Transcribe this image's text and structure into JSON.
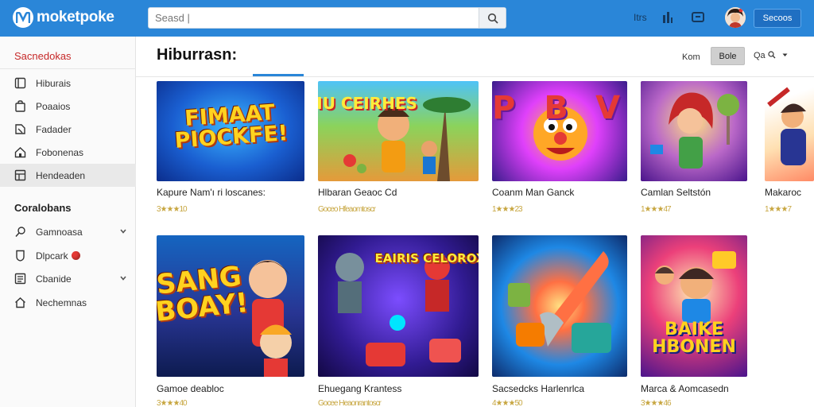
{
  "app": {
    "logo_text": "moketpoke",
    "logo_icon": "m-logo-icon"
  },
  "header": {
    "search_placeholder": "Seasd |",
    "link1": "Itrs",
    "action_button": "Secoos"
  },
  "sidebar": {
    "section1_title": "Sacnedokas",
    "items": [
      {
        "label": "Hiburais",
        "icon": "library-icon"
      },
      {
        "label": "Poaaios",
        "icon": "bag-icon"
      },
      {
        "label": "Fadader",
        "icon": "tag-icon"
      },
      {
        "label": "Fobonenas",
        "icon": "home-icon"
      },
      {
        "label": "Hendeaden",
        "icon": "grid-icon"
      }
    ],
    "section2_title": "Coralobans",
    "items2": [
      {
        "label": "Gamnoasa",
        "icon": "pin-icon"
      },
      {
        "label": "Dlpcark",
        "icon": "shield-icon"
      },
      {
        "label": "Cbanide",
        "icon": "list-icon"
      },
      {
        "label": "Nechemnas",
        "icon": "house-icon"
      }
    ]
  },
  "main": {
    "title": "Hiburrasn:",
    "sort_label": "Kom",
    "filter_button": "Bole",
    "options_label": "Qa"
  },
  "games_row1": [
    {
      "title": "Kapure Nam'ı ri loscanes:",
      "sub": "3★★★10",
      "thumb_text": "FIMAAT PIOCKFE!"
    },
    {
      "title": "Hlbaran Geaoc Cd",
      "sub": "Goceo Hfeaomtoscr",
      "thumb_text": "SHIU CEIRHES"
    },
    {
      "title": "Coanm Man Ganck",
      "sub": "1★★★23",
      "thumb_text": "PBV"
    },
    {
      "title": "Camlan Seltstón",
      "sub": "1★★★47",
      "thumb_text": ""
    },
    {
      "title": "Makaroc",
      "sub": "1★★★7",
      "thumb_text": ""
    }
  ],
  "games_row2": [
    {
      "title": "Gamoe deabloc",
      "sub": "3★★★40",
      "thumb_text": "SANG BOAY!"
    },
    {
      "title": "Ehuegang Krantess",
      "sub": "Gocee Heaonrantoscr",
      "thumb_text": "EAIRIS CELOROX"
    },
    {
      "title": "Sacsedcks Harlenrlca",
      "sub": "4★★★50",
      "thumb_text": ""
    },
    {
      "title": "Marca & Aomcasedn",
      "sub": "3★★★46",
      "thumb_text": "BAIKE HBONEN"
    }
  ],
  "colors": {
    "topbar": "#2a86d8",
    "accent_red": "#c62828",
    "star": "#c7a640"
  }
}
